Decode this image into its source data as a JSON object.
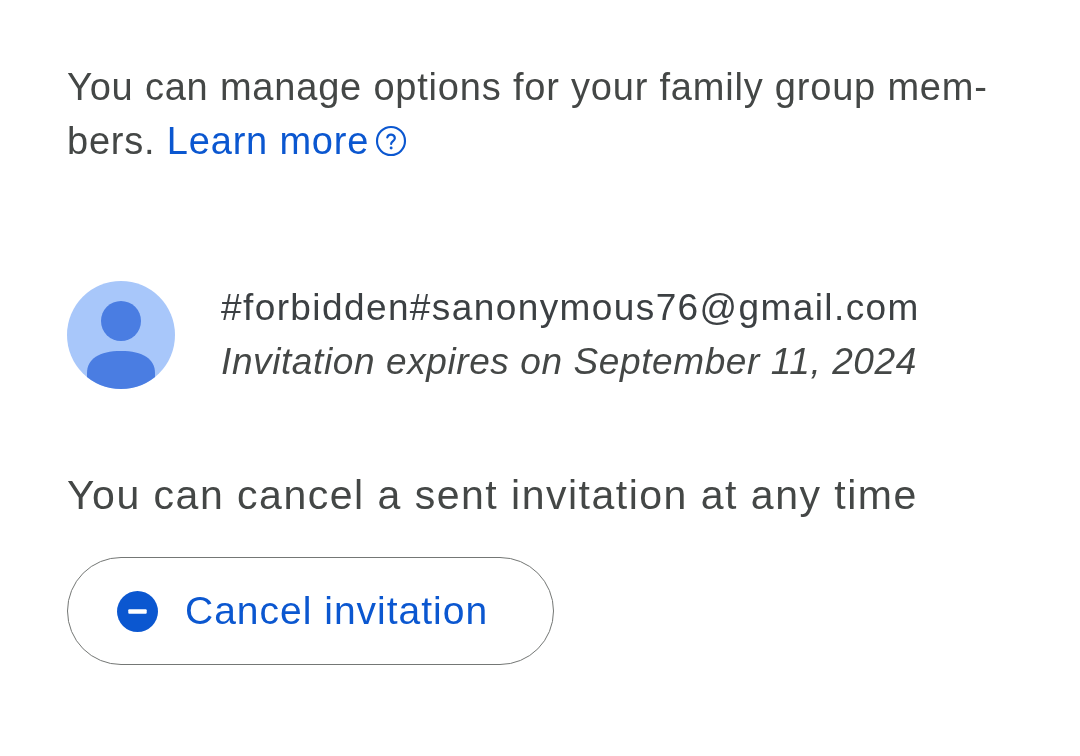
{
  "intro": {
    "text": "You can manage options for your family group mem-bers.",
    "link": "Learn more"
  },
  "invitation": {
    "email": "#forbidden#sanonymous76@gmail.com",
    "status": "Invitation expires on September 11, 2024"
  },
  "note": "You can cancel a sent invitation at any time",
  "cancel_button": {
    "label": "Cancel invitation"
  }
}
